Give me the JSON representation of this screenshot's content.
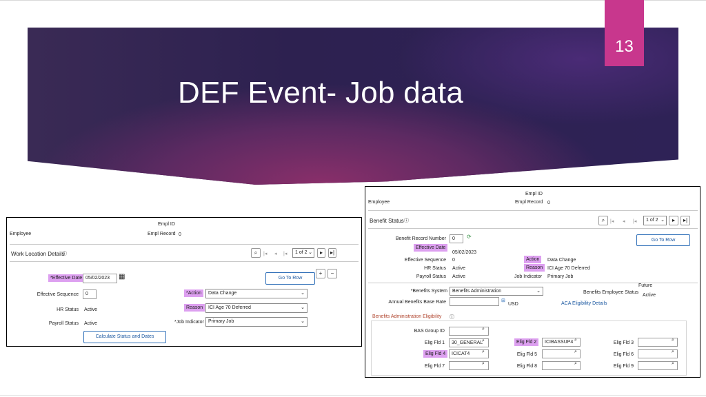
{
  "slide": {
    "title": "DEF Event- Job data",
    "page_number": "13"
  },
  "left_shot": {
    "empl_id_label": "Empl ID",
    "empl_record_label": "Empl Record",
    "empl_record_value": "0",
    "employee_label": "Employee",
    "section_title": "Work Location Details",
    "help_icon": "question-circle-icon",
    "pager": "1 of 2",
    "effective_date_label": "*Effective Date",
    "effective_date_value": "05/02/2023",
    "go_to_row": "Go To Row",
    "effective_sequence_label": "Effective Sequence",
    "effective_sequence_value": "0",
    "action_label": "*Action",
    "action_value": "Data Change",
    "hr_status_label": "HR Status",
    "hr_status_value": "Active",
    "reason_label": "Reason",
    "reason_value": "ICI Age 70 Deferred",
    "payroll_status_label": "Payroll Status",
    "payroll_status_value": "Active",
    "job_indicator_label": "*Job Indicator",
    "job_indicator_value": "Primary Job",
    "calc_button": "Calculate Status and Dates",
    "plus": "+",
    "minus": "−"
  },
  "right_shot": {
    "empl_id_label": "Empl ID",
    "employee_label": "Employee",
    "empl_record_label": "Empl Record",
    "empl_record_value": "0",
    "section_title": "Benefit Status",
    "pager": "1 of 2",
    "benefit_record_label": "Benefit Record Number",
    "benefit_record_value": "0",
    "go_to_row": "Go To Row",
    "effective_date_label": "Effective Date",
    "effective_date_value": "05/02/2023",
    "effective_sequence_label": "Effective Sequence",
    "effective_sequence_value": "0",
    "action_label": "Action",
    "action_value": "Data Change",
    "hr_status_label": "HR Status",
    "hr_status_value": "Active",
    "reason_label": "Reason",
    "reason_value": "ICI Age 70 Deferred",
    "payroll_status_label": "Payroll Status",
    "payroll_status_value": "Active",
    "job_indicator_label": "Job Indicator",
    "job_indicator_value": "Primary Job",
    "benefits_system_label": "*Benefits System",
    "benefits_system_value": "Benefits Administration",
    "future_label": "Future",
    "benefits_emp_status_label": "Benefits Employee Status",
    "benefits_emp_status_value": "Active",
    "annual_base_rate_label": "Annual Benefits Base Rate",
    "currency": "USD",
    "aca_link": "ACA Eligibility Details",
    "eligibility_title": "Benefits Administration Eligibility",
    "bas_group_label": "BAS Group ID",
    "elig_fld_1_label": "Elig Fld 1",
    "elig_fld_1_value": "30_GENERAL",
    "elig_fld_2_label": "Elig Fld 2",
    "elig_fld_2_value": "ICIBASSUP4",
    "elig_fld_3_label": "Elig Fld 3",
    "elig_fld_4_label": "Elig Fld 4",
    "elig_fld_4_value": "ICICAT4",
    "elig_fld_5_label": "Elig Fld 5",
    "elig_fld_6_label": "Elig Fld 6",
    "elig_fld_7_label": "Elig Fld 7",
    "elig_fld_8_label": "Elig Fld 8",
    "elig_fld_9_label": "Elig Fld 9"
  },
  "colors": {
    "page_tab": "#c8378d",
    "highlight": "#dda0f0",
    "link": "#1a57a0"
  }
}
